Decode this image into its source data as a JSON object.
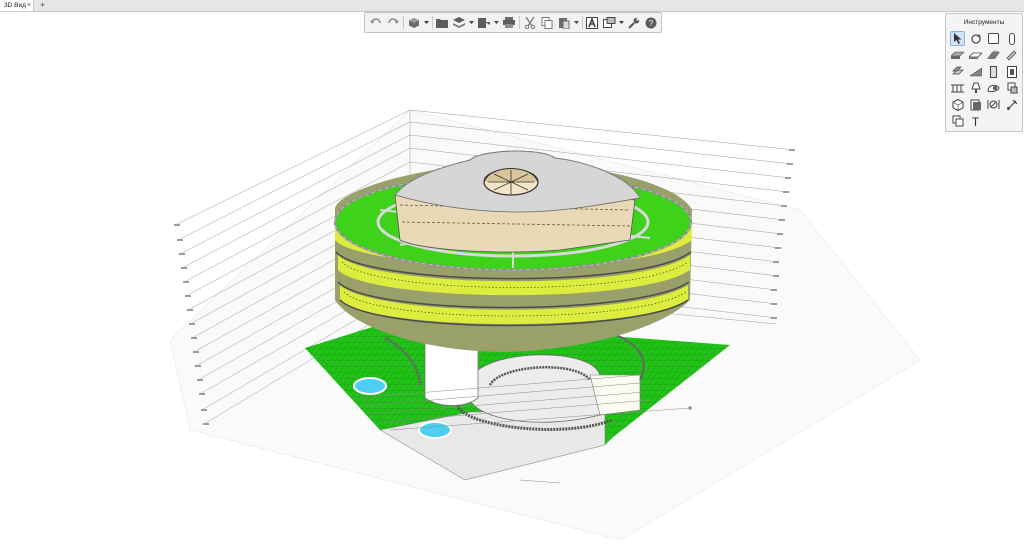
{
  "tab": {
    "label": "3D Вид",
    "close": "×",
    "add": "+"
  },
  "toolbar": {
    "buttons": [
      "undo-icon",
      "redo-icon",
      "view-cube-icon",
      "folder-icon",
      "layers-icon",
      "export-icon",
      "print-icon",
      "cut-icon",
      "copy-icon",
      "paste-icon",
      "text-style-icon",
      "view-settings-icon",
      "wrench-icon",
      "help-icon"
    ]
  },
  "tools_panel": {
    "title": "Инструменты",
    "active_tool": "select-arrow-icon",
    "text_tool_glyph": "T"
  },
  "colors": {
    "roof_green": "#3fd21a",
    "balcony_yellow": "#e4f53a",
    "pool_blue": "#4ccff0",
    "ground_green": "#22c218"
  }
}
